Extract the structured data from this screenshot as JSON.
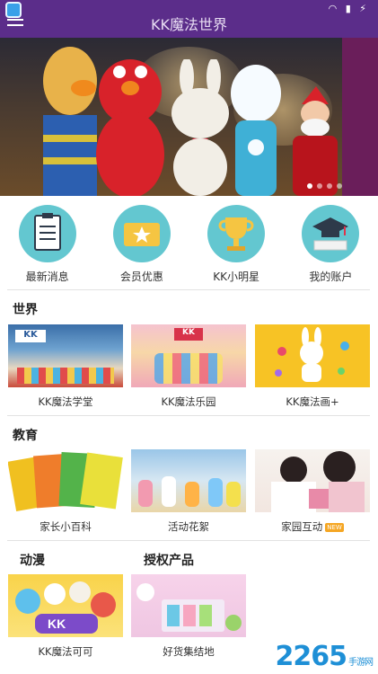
{
  "header": {
    "title": "KK魔法世界"
  },
  "quick_nav": [
    {
      "label": "最新消息",
      "icon": "document-icon"
    },
    {
      "label": "会员优惠",
      "icon": "ticket-star-icon"
    },
    {
      "label": "KK小明星",
      "icon": "trophy-icon"
    },
    {
      "label": "我的账户",
      "icon": "graduation-cap-icon"
    }
  ],
  "sections": {
    "world": {
      "title": "世界",
      "items": [
        {
          "label": "KK魔法学堂"
        },
        {
          "label": "KK魔法乐园"
        },
        {
          "label": "KK魔法画+"
        }
      ]
    },
    "education": {
      "title": "教育",
      "items": [
        {
          "label": "家长小百科"
        },
        {
          "label": "活动花絮"
        },
        {
          "label": "家园互动",
          "badge": "NEW"
        }
      ]
    },
    "anime": {
      "title": "动漫",
      "items": [
        {
          "label": "KK魔法可可"
        }
      ]
    },
    "licensed": {
      "title": "授权产品",
      "items": [
        {
          "label": "好货集结地"
        }
      ]
    }
  },
  "watermark": {
    "text": "2265",
    "sub": "手游网"
  },
  "colors": {
    "header": "#5b2d8a",
    "icon_circle": "#63c7d0"
  }
}
